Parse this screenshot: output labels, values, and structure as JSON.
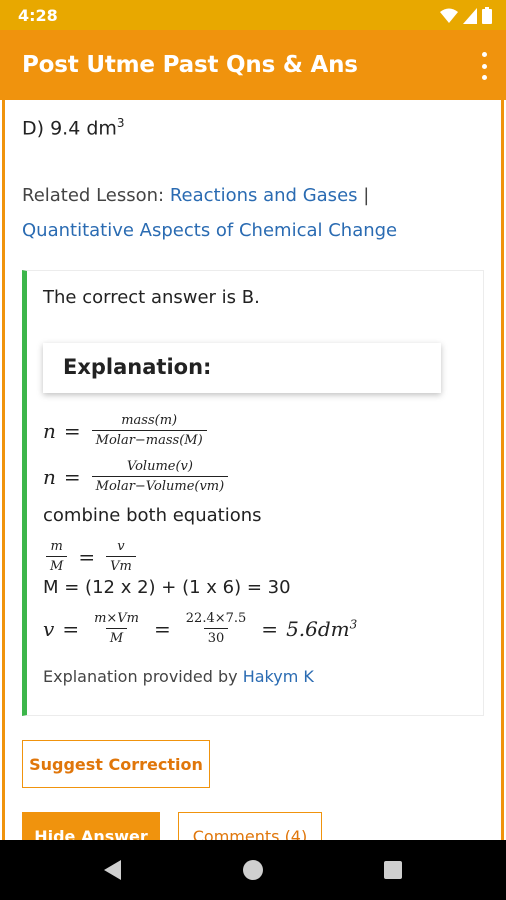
{
  "status_bar": {
    "time": "4:28",
    "wifi_icon": "wifi-icon",
    "signal_icon": "signal-icon",
    "battery_icon": "battery-icon"
  },
  "app_bar": {
    "title": "Post Utme Past Qns & Ans",
    "menu_icon": "more-vert-icon"
  },
  "question": {
    "option_label": "D) 9.4 dm",
    "option_sup": "3"
  },
  "related": {
    "label": "Related Lesson: ",
    "link1": "Reactions and Gases",
    "separator": " | ",
    "link2": "Quantitative Aspects of Chemical Change"
  },
  "answer": {
    "correct_text": "The correct answer is B.",
    "explanation_title": "Explanation:",
    "eq1": {
      "lhs": "n",
      "eq": "=",
      "num": "mass(m)",
      "den": "Molar−mass(M)"
    },
    "eq2": {
      "lhs": "n",
      "eq": "=",
      "num": "Volume(v)",
      "den": "Molar−Volume(vm)"
    },
    "combine_text": "combine both equations",
    "eq3": {
      "num1": "m",
      "den1": "M",
      "eq": "=",
      "num2": "v",
      "den2": "Vm"
    },
    "molar_mass_line": "M = (12 x 2) + (1 x 6) = 30",
    "eq4": {
      "lhs": "v",
      "eq": "=",
      "num1": "m×Vm",
      "den1": "M",
      "num2": "22.4×7.5",
      "den2": "30",
      "result": "5.6dm",
      "result_sup": "3"
    },
    "credit_label": "Explanation provided by ",
    "credit_name": "Hakym K"
  },
  "buttons": {
    "suggest": "Suggest Correction",
    "hide": "Hide Answer",
    "comments": "Comments (4)"
  },
  "nav": {
    "back_icon": "back-triangle-icon",
    "home_icon": "home-circle-icon",
    "recents_icon": "recents-square-icon"
  },
  "colors": {
    "status": "#e8a800",
    "app_bar": "#f0930d",
    "link": "#2a6bb2",
    "correct_border": "#3cb64a"
  }
}
